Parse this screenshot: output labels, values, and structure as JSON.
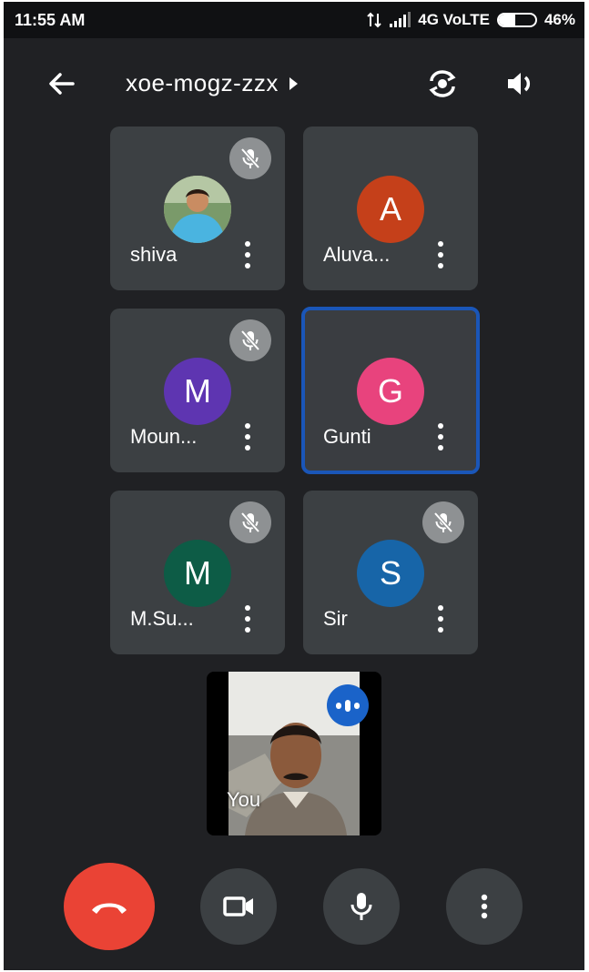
{
  "status_bar": {
    "time": "11:55 AM",
    "network": "4G VoLTE",
    "battery": "46%",
    "battery_level": 0.46
  },
  "header": {
    "meeting_code": "xoe-mogz-zzx",
    "back_icon": "arrow-left-icon",
    "switch_camera_icon": "camera-switch-icon",
    "audio_icon": "speaker-icon"
  },
  "participants": [
    {
      "name": "shiva",
      "initial": "",
      "avatar_type": "photo",
      "muted": true,
      "active": false
    },
    {
      "name": "Aluva...",
      "initial": "A",
      "avatar_color": "#c5401a",
      "muted": false,
      "active": false
    },
    {
      "name": "Moun...",
      "initial": "M",
      "avatar_color": "#5e35b1",
      "muted": true,
      "active": false
    },
    {
      "name": "Gunti",
      "initial": "G",
      "avatar_color": "#e8437d",
      "muted": false,
      "active": true
    },
    {
      "name": "M.Su...",
      "initial": "M",
      "avatar_color": "#0d5c46",
      "muted": true,
      "active": false
    },
    {
      "name": "Sir",
      "initial": "S",
      "avatar_color": "#1765a8",
      "muted": true,
      "active": false
    }
  ],
  "self_view": {
    "label": "You",
    "speaking": true
  },
  "controls": {
    "end_call_icon": "phone-hangup-icon",
    "camera_icon": "video-camera-icon",
    "mic_icon": "microphone-icon",
    "more_icon": "more-vertical-icon"
  },
  "colors": {
    "background": "#202124",
    "tile": "#3c4043",
    "end_call": "#ea4335",
    "active_border": "#1a56b8",
    "speaking_badge": "#1a63c9"
  }
}
